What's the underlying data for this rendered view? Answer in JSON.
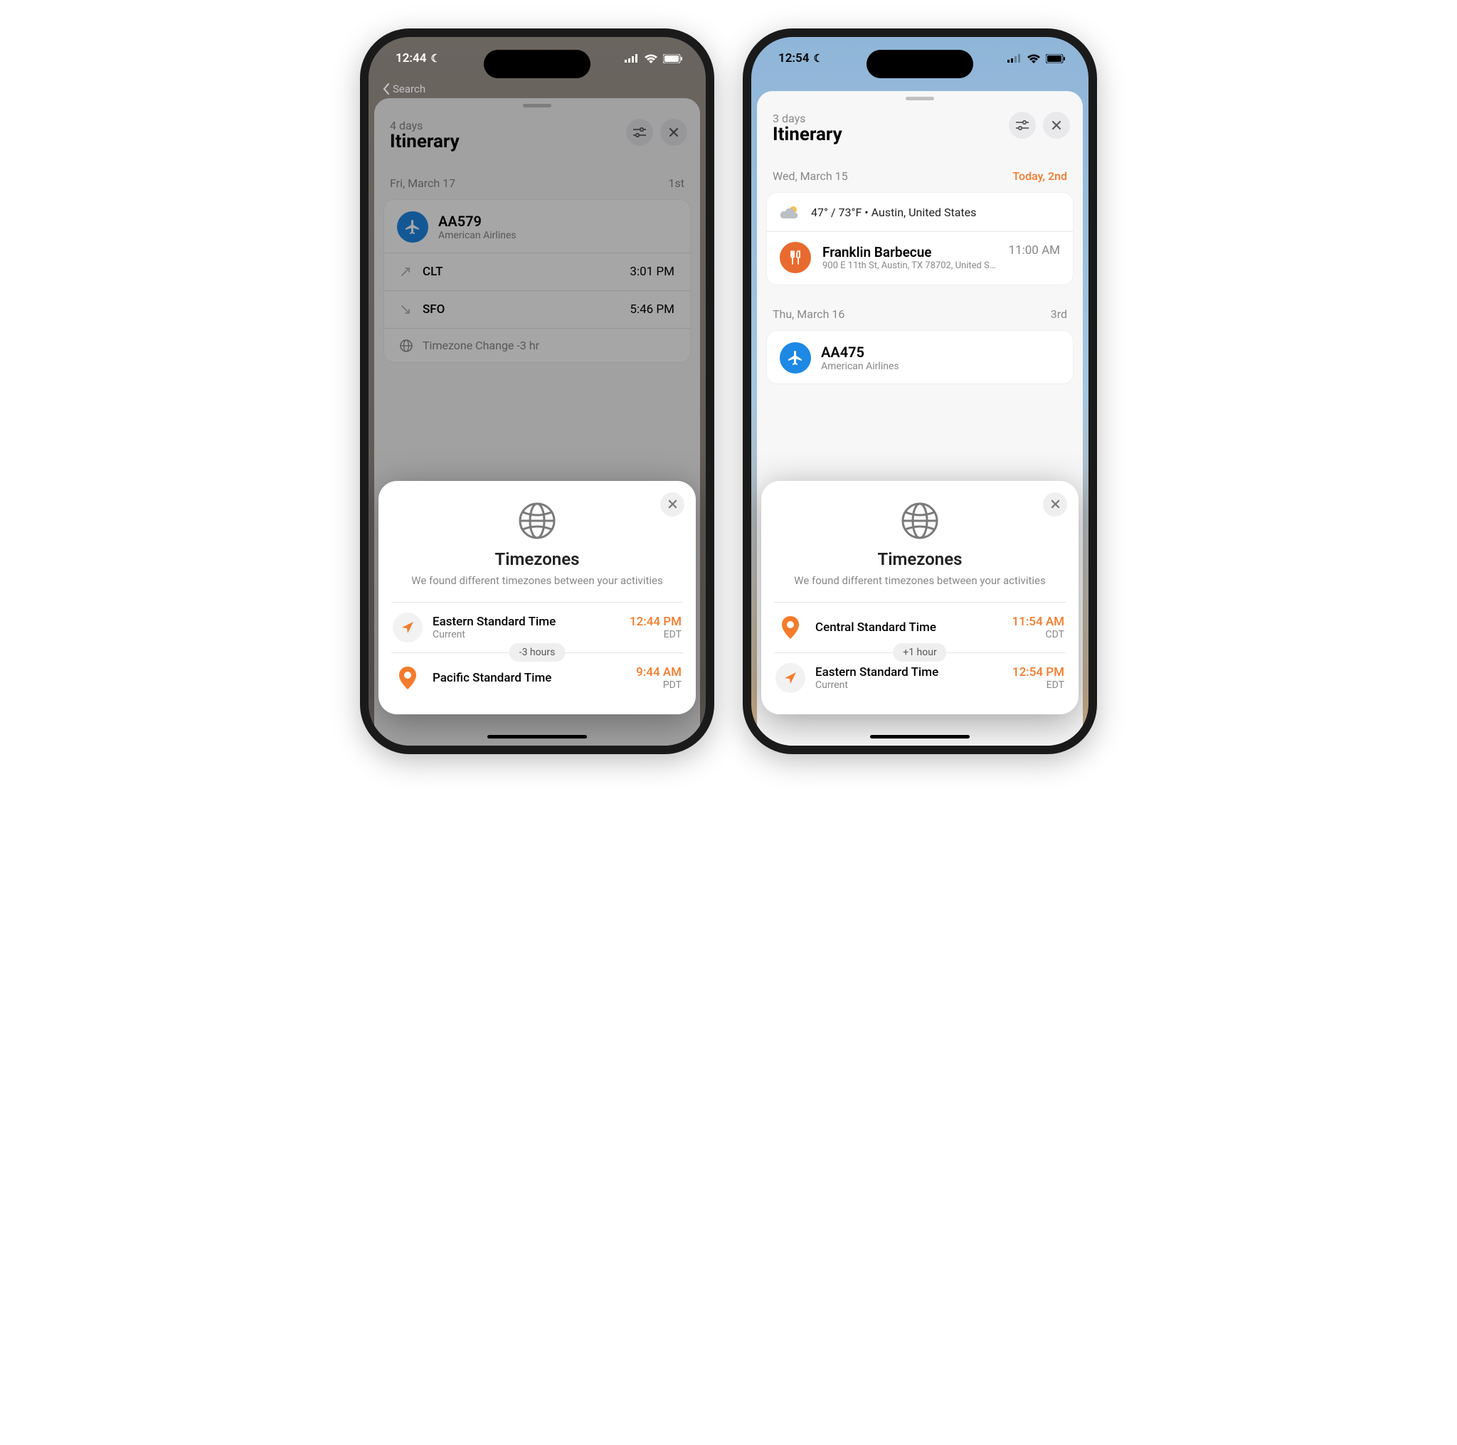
{
  "left": {
    "status_time": "12:44",
    "back_label": "Search",
    "sheet": {
      "subtitle": "4 days",
      "title": "Itinerary"
    },
    "day": {
      "date": "Fri, March 17",
      "ord": "1st"
    },
    "flight": {
      "code": "AA579",
      "airline": "American Airlines",
      "dep_code": "CLT",
      "dep_time": "3:01 PM",
      "arr_code": "SFO",
      "arr_time": "5:46 PM",
      "tz_change": "Timezone Change -3 hr"
    },
    "modal": {
      "title": "Timezones",
      "desc": "We found different timezones between your activities",
      "diff": "-3 hours",
      "items": [
        {
          "name": "Eastern Standard Time",
          "current": "Current",
          "time": "12:44 PM",
          "abbr": "EDT",
          "kind": "nav"
        },
        {
          "name": "Pacific Standard Time",
          "current": "",
          "time": "9:44 AM",
          "abbr": "PDT",
          "kind": "pin"
        }
      ]
    }
  },
  "right": {
    "status_time": "12:54",
    "sheet": {
      "subtitle": "3 days",
      "title": "Itinerary"
    },
    "day1": {
      "date": "Wed, March 15",
      "ord": "Today, 2nd"
    },
    "weather": "47° / 73°F • Austin, United States",
    "place": {
      "name": "Franklin Barbecue",
      "addr": "900 E 11th St, Austin, TX  78702, United States",
      "time": "11:00 AM"
    },
    "day2": {
      "date": "Thu, March 16",
      "ord": "3rd"
    },
    "flight": {
      "code": "AA475",
      "airline": "American Airlines"
    },
    "modal": {
      "title": "Timezones",
      "desc": "We found different timezones between your activities",
      "diff": "+1 hour",
      "items": [
        {
          "name": "Central Standard Time",
          "current": "",
          "time": "11:54 AM",
          "abbr": "CDT",
          "kind": "pin"
        },
        {
          "name": "Eastern Standard Time",
          "current": "Current",
          "time": "12:54 PM",
          "abbr": "EDT",
          "kind": "nav"
        }
      ]
    }
  }
}
